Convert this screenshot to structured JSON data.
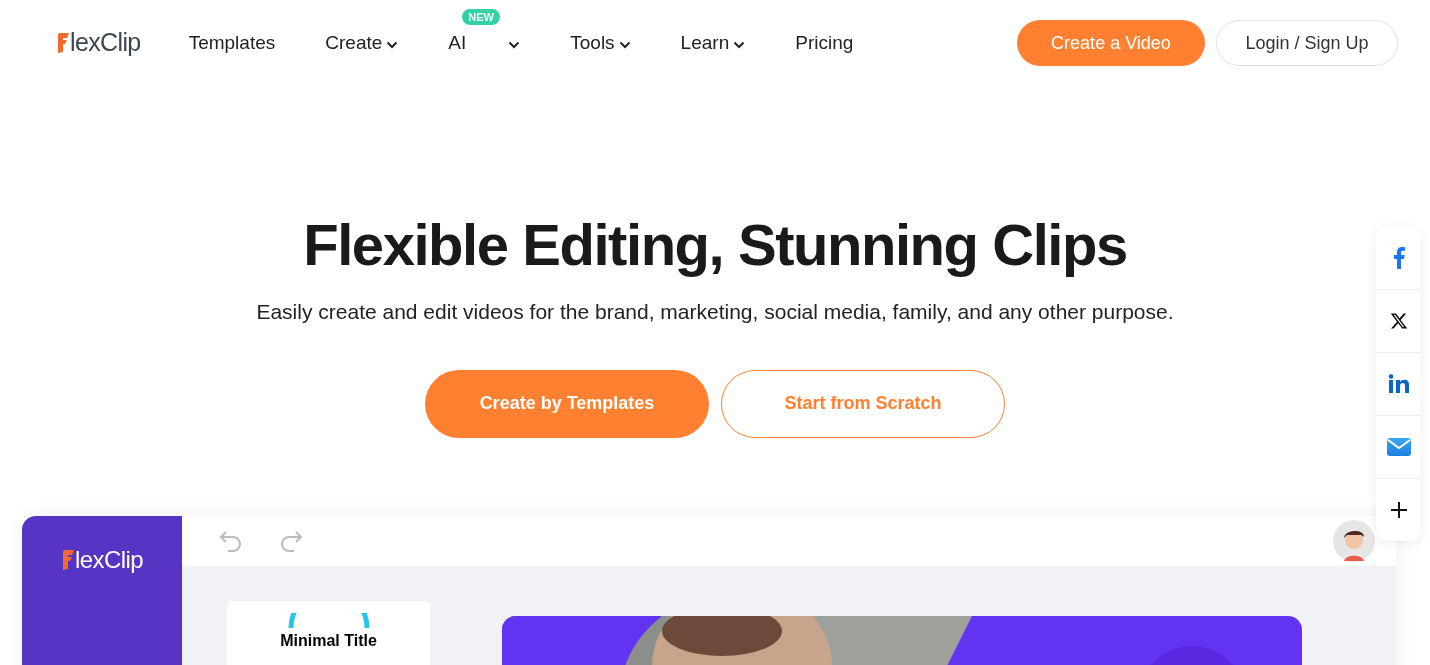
{
  "header": {
    "logo": "lexClip",
    "nav": [
      {
        "label": "Templates",
        "dropdown": false
      },
      {
        "label": "Create",
        "dropdown": true
      },
      {
        "label": "AI",
        "dropdown": true,
        "badge": "NEW"
      },
      {
        "label": "Tools",
        "dropdown": true
      },
      {
        "label": "Learn",
        "dropdown": true
      },
      {
        "label": "Pricing",
        "dropdown": false
      }
    ],
    "cta": "Create a Video",
    "login": "Login / Sign Up"
  },
  "hero": {
    "title": "Flexible Editing, Stunning Clips",
    "subtitle": "Easily create and edit videos for the brand, marketing, social media, family, and any other purpose.",
    "buttons": [
      {
        "label": "Create by Templates",
        "kind": "primary"
      },
      {
        "label": "Start from Scratch",
        "kind": "outline"
      }
    ]
  },
  "share": [
    {
      "kind": "facebook"
    },
    {
      "kind": "x"
    },
    {
      "kind": "linkedin"
    },
    {
      "kind": "email"
    },
    {
      "kind": "more"
    }
  ],
  "editor": {
    "logo": "lexClip",
    "card_title": "Minimal Title"
  }
}
